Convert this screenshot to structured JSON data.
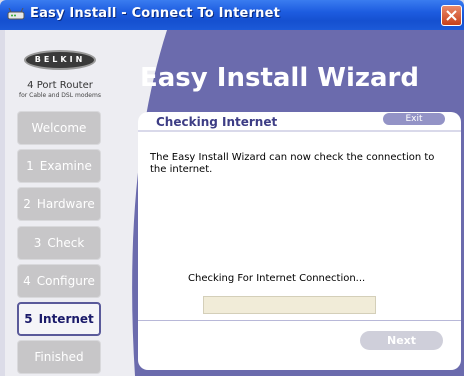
{
  "window": {
    "title": "Easy Install - Connect To Internet",
    "close_icon": "close-icon",
    "app_icon": "router-icon"
  },
  "sidebar": {
    "logo": "BELKIN",
    "product_name": "4 Port Router",
    "product_subtitle": "for Cable and DSL modems",
    "steps": [
      {
        "number": "",
        "label": "Welcome",
        "state": "disabled"
      },
      {
        "number": "1",
        "label": "Examine",
        "state": "disabled"
      },
      {
        "number": "2",
        "label": "Hardware",
        "state": "disabled"
      },
      {
        "number": "3",
        "label": "Check",
        "state": "disabled"
      },
      {
        "number": "4",
        "label": "Configure",
        "state": "disabled"
      },
      {
        "number": "5",
        "label": "Internet",
        "state": "active"
      },
      {
        "number": "",
        "label": "Finished",
        "state": "disabled"
      }
    ]
  },
  "main": {
    "wizard_title": "Easy Install Wizard",
    "panel": {
      "title": "Checking Internet",
      "exit_label": "Exit",
      "description": "The Easy Install Wizard can now check the connection to the internet.",
      "status_text": "Checking For Internet Connection...",
      "progress": 0,
      "next_label": "Next"
    }
  },
  "colors": {
    "accent": "#6b6bad",
    "title_bar": "#1d5ce0",
    "progress_track": "#f1ecd8"
  }
}
